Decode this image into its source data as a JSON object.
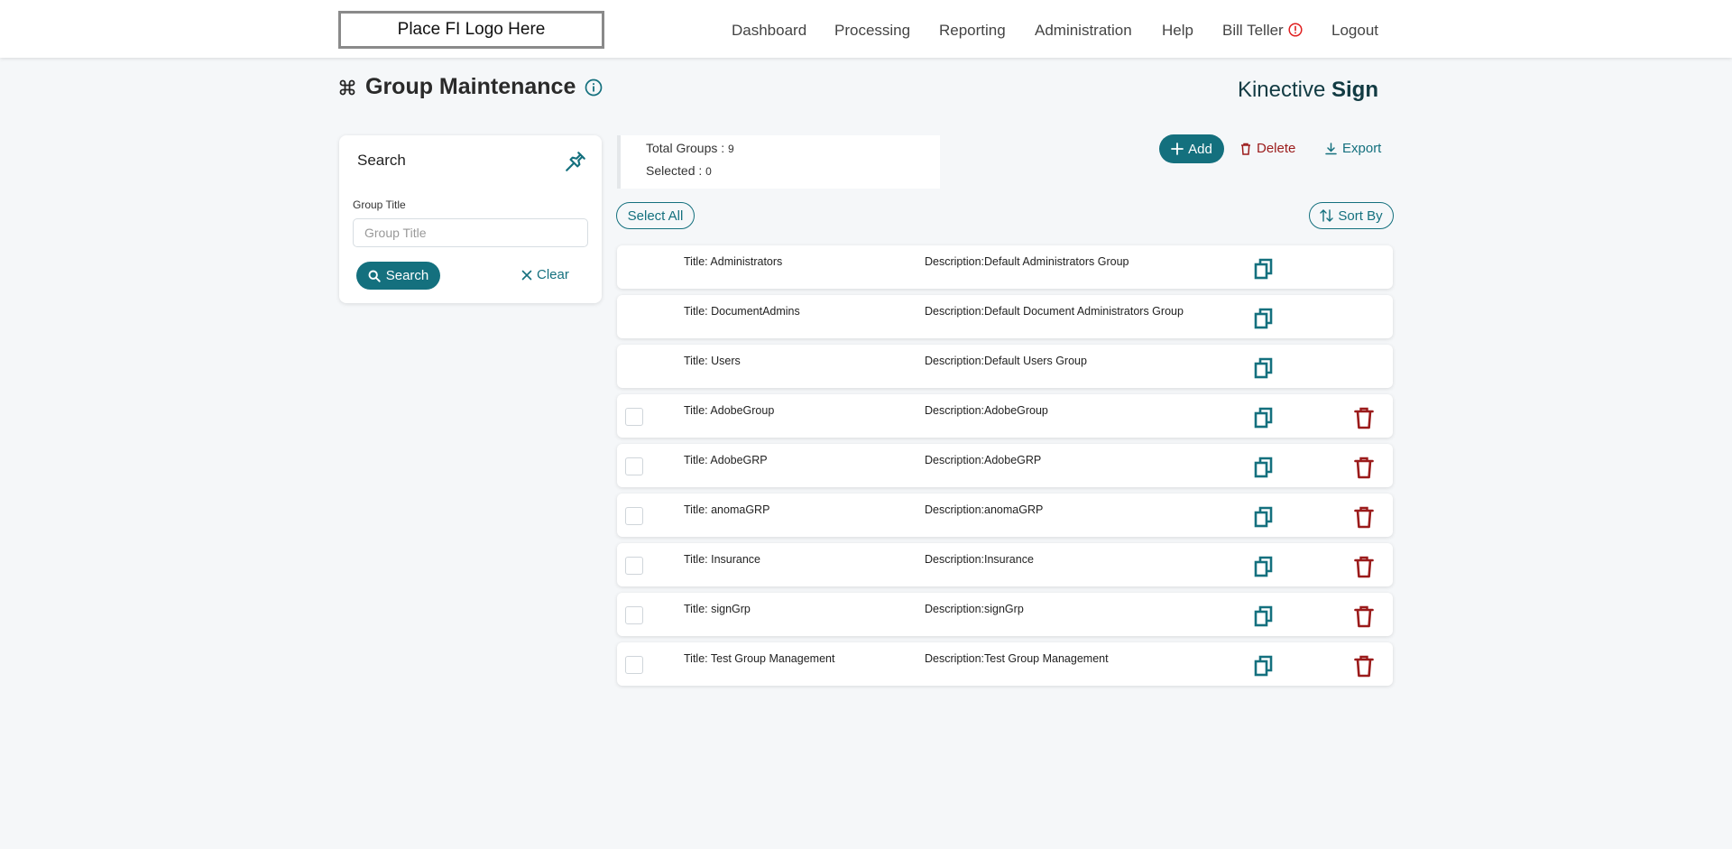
{
  "header": {
    "logo_text": "Place FI Logo Here",
    "nav": [
      "Dashboard",
      "Processing",
      "Reporting",
      "Administration",
      "Help",
      "Bill Teller",
      "Logout"
    ],
    "alert_color": "#e02020"
  },
  "page": {
    "title": "Group Maintenance",
    "brand_light": "Kinective ",
    "brand_bold": "Sign"
  },
  "search": {
    "title": "Search",
    "field_label": "Group Title",
    "field_placeholder": "Group Title",
    "field_value": "",
    "search_label": "Search",
    "clear_label": "Clear"
  },
  "summary": {
    "total_label": "Total Groups : ",
    "total_value": "9",
    "selected_label": "Selected : ",
    "selected_value": "0"
  },
  "actions": {
    "add_label": "Add",
    "delete_label": "Delete",
    "export_label": "Export",
    "select_all_label": "Select All",
    "sort_by_label": "Sort By"
  },
  "colors": {
    "accent": "#14707e",
    "danger": "#9b1b1b"
  },
  "groups": [
    {
      "title": "Title: Administrators",
      "description": "Description:Default Administrators Group",
      "system": true
    },
    {
      "title": "Title: DocumentAdmins",
      "description": "Description:Default Document Administrators Group",
      "system": true
    },
    {
      "title": "Title: Users",
      "description": "Description:Default Users Group",
      "system": true
    },
    {
      "title": "Title: AdobeGroup",
      "description": "Description:AdobeGroup",
      "system": false
    },
    {
      "title": "Title: AdobeGRP",
      "description": "Description:AdobeGRP",
      "system": false
    },
    {
      "title": "Title: anomaGRP",
      "description": "Description:anomaGRP",
      "system": false
    },
    {
      "title": "Title: Insurance",
      "description": "Description:Insurance",
      "system": false
    },
    {
      "title": "Title: signGrp",
      "description": "Description:signGrp",
      "system": false
    },
    {
      "title": "Title: Test Group Management",
      "description": "Description:Test Group Management",
      "system": false
    }
  ]
}
